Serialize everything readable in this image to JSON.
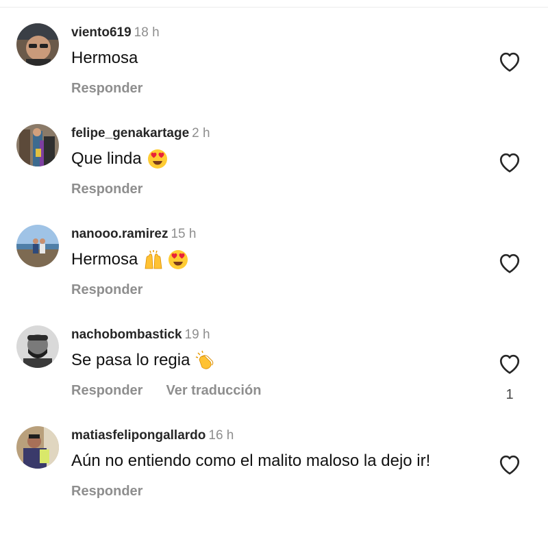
{
  "comments": [
    {
      "username": "viento619",
      "time": "18 h",
      "text": "Hermosa",
      "emojis": [],
      "reply_label": "Responder",
      "translate_label": "",
      "like_count": ""
    },
    {
      "username": "felipe_genakartage",
      "time": "2 h",
      "text": "Que linda",
      "emojis": [
        "heart-eyes-emoji"
      ],
      "reply_label": "Responder",
      "translate_label": "",
      "like_count": ""
    },
    {
      "username": "nanooo.ramirez",
      "time": "15 h",
      "text": "Hermosa",
      "emojis": [
        "raising-hands-emoji",
        "heart-eyes-emoji"
      ],
      "reply_label": "Responder",
      "translate_label": "",
      "like_count": ""
    },
    {
      "username": "nachobombastick",
      "time": "19 h",
      "text": "Se pasa lo regia",
      "emojis": [
        "clapping-hands-emoji"
      ],
      "reply_label": "Responder",
      "translate_label": "Ver traducción",
      "like_count": "1"
    },
    {
      "username": "matiasfelipongallardo",
      "time": "16 h",
      "text": "Aún no entiendo como el malito maloso la dejo ir!",
      "emojis": [],
      "reply_label": "Responder",
      "translate_label": "",
      "like_count": ""
    }
  ],
  "colors": {
    "username": "#262626",
    "secondary": "#8e8e8e",
    "text": "#111111",
    "heart_outline": "#262626"
  },
  "icons": {
    "like": "heart-outline-icon"
  }
}
